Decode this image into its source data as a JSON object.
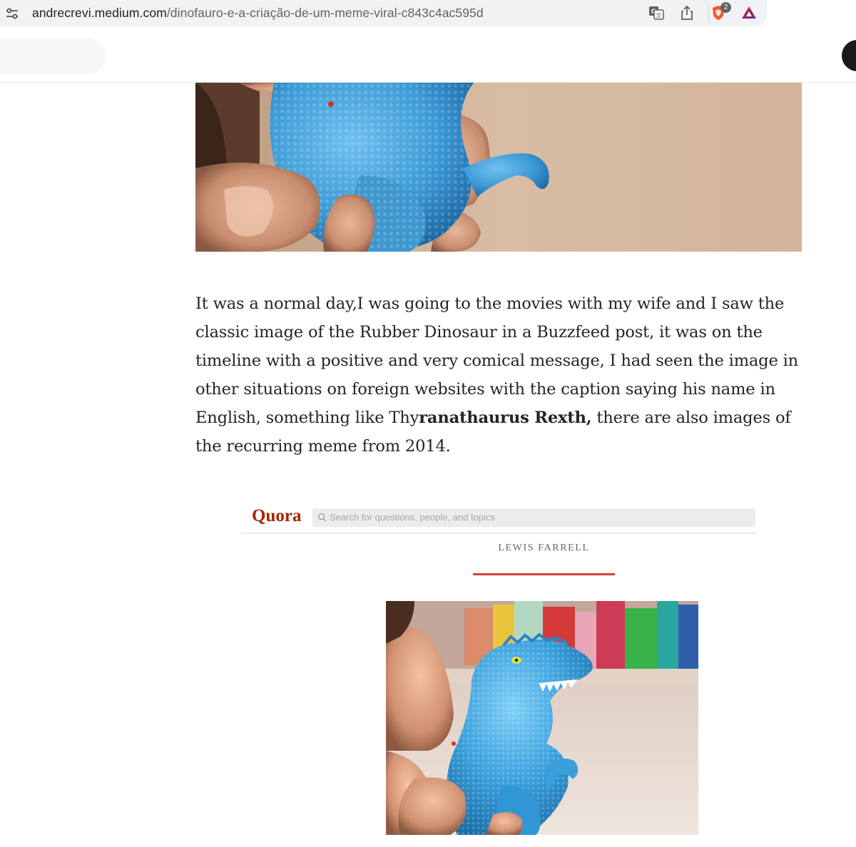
{
  "browser": {
    "url_host": "andrecrevi.medium.com",
    "url_path": "/dinofauro-e-a-criação-de-um-meme-viral-c843c4ac595d",
    "icons": [
      "site-settings-icon",
      "translate-icon",
      "share-icon",
      "brave-shields-icon",
      "brave-rewards-icon"
    ],
    "shields_count": "2"
  },
  "article": {
    "paragraph": {
      "before": "It was a normal day,I was going to the movies with my wife and I saw the classic image of the Rubber Dinosaur in a Buzzfeed post, it was on the timeline with a positive and very comical message, I had seen the image in other situations on foreign websites with the caption saying his name in English, something like Thy",
      "bold": "ranathaurus Rexth,",
      "after": " there are also images of the recurring meme from 2014."
    },
    "embedded_screenshot": {
      "logo": "Quora",
      "search_placeholder": "Search for questions, people, and topics",
      "author": "LEWIS FARRELL"
    }
  },
  "colors": {
    "text": "#242424",
    "quora_red": "#a82400",
    "dino_blue": "#3d9bd6"
  }
}
